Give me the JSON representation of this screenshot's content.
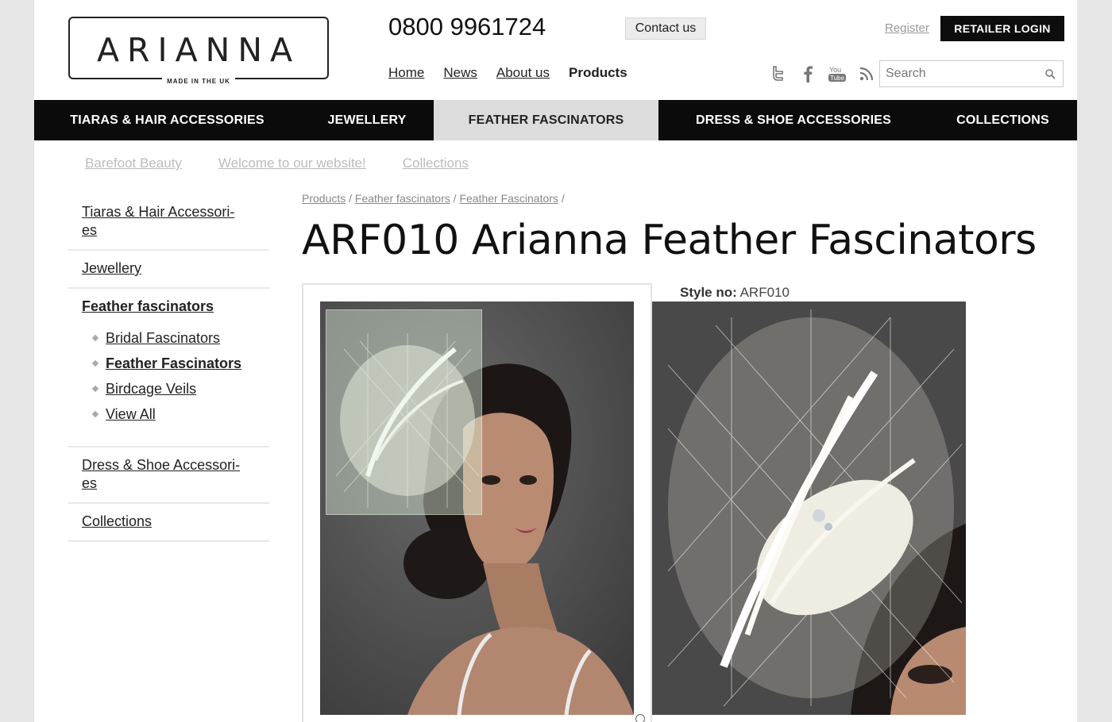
{
  "header": {
    "logo_text": "ARIANNA",
    "logo_tagline": "MADE IN THE UK",
    "phone": "0800 9961724",
    "contact_label": "Contact us",
    "top_nav": [
      {
        "label": "Home"
      },
      {
        "label": "News"
      },
      {
        "label": "About us"
      },
      {
        "label": "Products"
      }
    ],
    "register_label": "Register",
    "retailer_login_label": "RETAILER LOGIN",
    "social_icons": [
      "twitter-icon",
      "facebook-icon",
      "youtube-icon",
      "rss-icon"
    ],
    "search_placeholder": "Search"
  },
  "main_nav": [
    {
      "label": "TIARAS & HAIR ACCESSORIES"
    },
    {
      "label": "JEWELLERY"
    },
    {
      "label": "FEATHER FASCINATORS",
      "active": true
    },
    {
      "label": "DRESS & SHOE ACCESSORIES"
    },
    {
      "label": "COLLECTIONS"
    }
  ],
  "sub_links": [
    {
      "label": "Barefoot Beauty"
    },
    {
      "label": "Welcome to our website!"
    },
    {
      "label": "Collections"
    }
  ],
  "sidebar": {
    "tiaras": "Tiaras & Hair Accessori-\nes",
    "jewellery": "Jewellery",
    "feather": "Feather fascinators",
    "feather_items": [
      {
        "label": "Bridal Fascinators"
      },
      {
        "label": "Feather Fascinators",
        "active": true
      },
      {
        "label": "Birdcage Veils"
      },
      {
        "label": "View All"
      }
    ],
    "dress": "Dress & Shoe Accessori-\nes",
    "collections": "Collections"
  },
  "breadcrumb": [
    {
      "label": "Products"
    },
    {
      "label": "Feather fascinators"
    },
    {
      "label": "Feather Fascinators"
    }
  ],
  "product": {
    "title": "ARF010 Arianna Feather Fascinators",
    "style_label": "Style no:",
    "style_value": "ARF010"
  },
  "colors": {
    "nav_bg": "#0b0b0b",
    "nav_active_bg": "#dcdcdc",
    "photo_bg": "#4a4a4a"
  }
}
